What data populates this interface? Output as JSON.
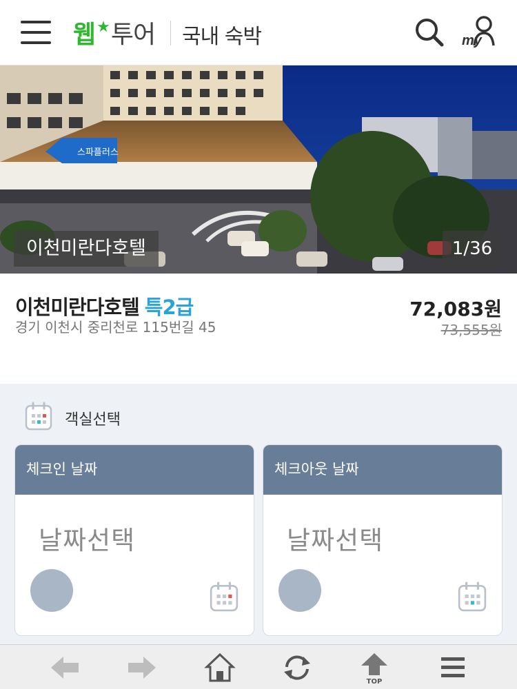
{
  "header": {
    "logo_web": "웹",
    "logo_mark": "★",
    "logo_tour": "투어",
    "title": "국내 숙박",
    "my_label": "my"
  },
  "hero": {
    "caption": "이천미란다호텔",
    "counter": "1/36",
    "sign_text": "스파플러스"
  },
  "hotel": {
    "name": "이천미란다호텔",
    "grade": "특2급",
    "address": "경기 이천시 중리천로 115번길 45",
    "price": "72,083원",
    "original_price": "73,555원"
  },
  "room_select": {
    "title": "객실선택",
    "checkin": {
      "header": "체크인 날짜",
      "placeholder": "날짜선택"
    },
    "checkout": {
      "header": "체크아웃 날짜",
      "placeholder": "날짜선택"
    }
  },
  "bottom_nav": {
    "top_label": "TOP"
  },
  "colors": {
    "brand_green": "#2fb82f",
    "grade_blue": "#2aa3d8",
    "card_header": "#687d97",
    "section_bg": "#eef2f6"
  }
}
